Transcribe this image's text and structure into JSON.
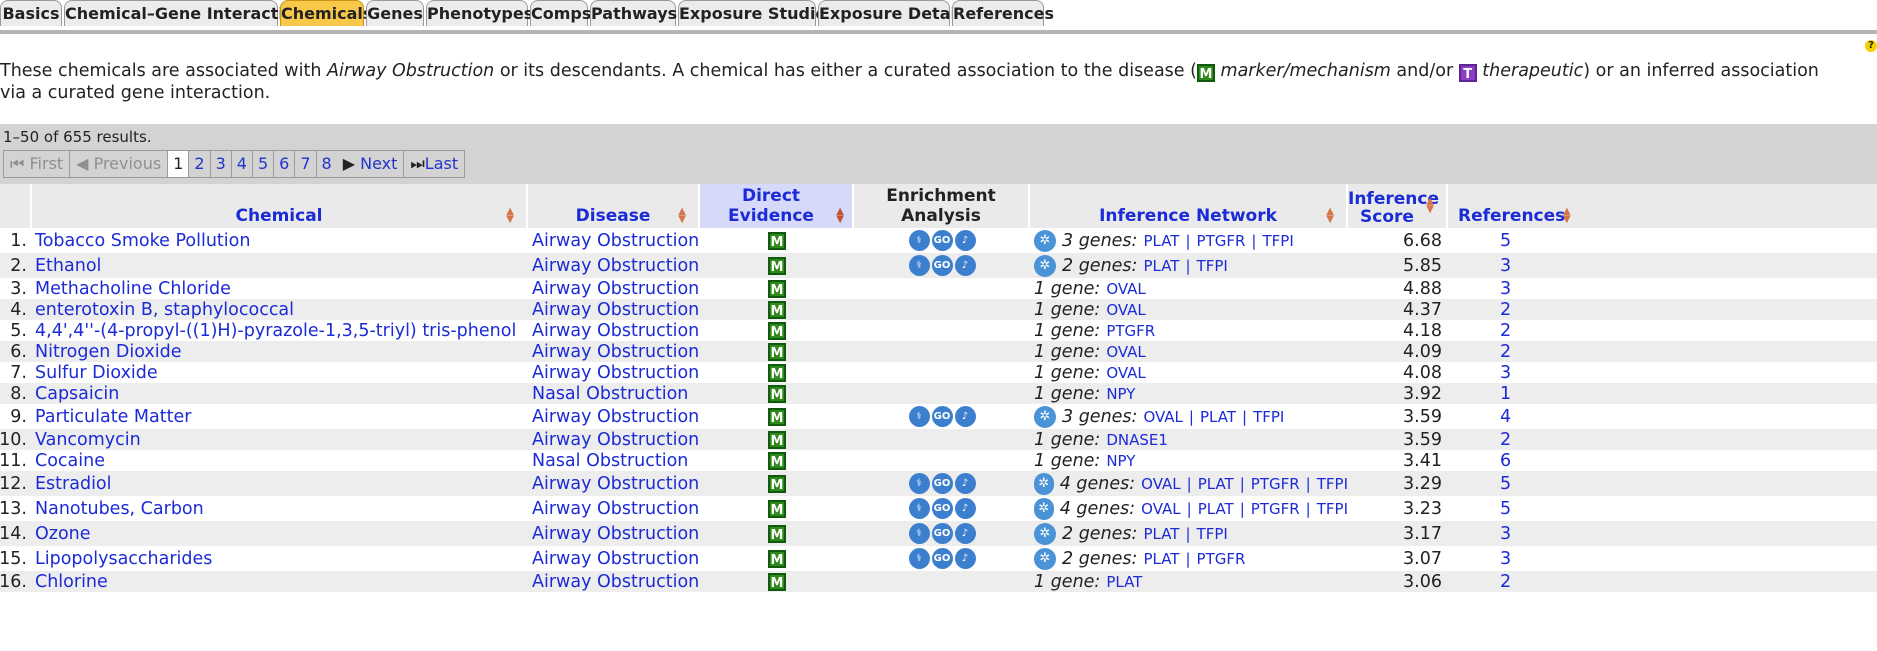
{
  "tabs": [
    "Basics",
    "Chemical–Gene Interactions",
    "Chemicals",
    "Genes",
    "Phenotypes",
    "Comps",
    "Pathways",
    "Exposure Studies",
    "Exposure Details",
    "References"
  ],
  "active_tab": "Chemicals",
  "help_label": "?",
  "intro": {
    "p1": "These chemicals are associated with ",
    "disease": "Airway Obstruction",
    "p2": " or its descendants. A chemical has either a curated association to the disease (",
    "m_badge": "M",
    "m_label": "marker/mechanism",
    "p3": " and/or ",
    "t_badge": "T",
    "t_label": "therapeutic",
    "p4": ") or an inferred association via a curated gene interaction."
  },
  "results_text": "1–50 of 655 results.",
  "pager": {
    "first": "First",
    "previous": "Previous",
    "pages": [
      "1",
      "2",
      "3",
      "4",
      "5",
      "6",
      "7",
      "8"
    ],
    "current": "1",
    "next": "Next",
    "last": "Last"
  },
  "columns": {
    "chemical": "Chemical",
    "disease": "Disease",
    "direct_evidence": "Direct Evidence",
    "enrichment": "Enrichment Analysis",
    "network": "Inference Network",
    "score_l1": "Inference",
    "score_l2": "Score",
    "references": "References"
  },
  "enrichment_icons": [
    "anatomy-icon",
    "go-icon",
    "pathway-icon"
  ],
  "network_icon": "network-icon",
  "rows": [
    {
      "n": "1.",
      "chemical": "Tobacco Smoke Pollution",
      "disease": "Airway Obstruction",
      "ev": "M",
      "enr": true,
      "gl": "3 genes:",
      "genes": [
        "PLAT",
        "PTGFR",
        "TFPI"
      ],
      "score": "6.68",
      "refs": "5"
    },
    {
      "n": "2.",
      "chemical": "Ethanol",
      "disease": "Airway Obstruction",
      "ev": "M",
      "enr": true,
      "gl": "2 genes:",
      "genes": [
        "PLAT",
        "TFPI"
      ],
      "score": "5.85",
      "refs": "3"
    },
    {
      "n": "3.",
      "chemical": "Methacholine Chloride",
      "disease": "Airway Obstruction",
      "ev": "M",
      "enr": false,
      "gl": "1 gene:",
      "genes": [
        "OVAL"
      ],
      "score": "4.88",
      "refs": "3"
    },
    {
      "n": "4.",
      "chemical": "enterotoxin B, staphylococcal",
      "disease": "Airway Obstruction",
      "ev": "M",
      "enr": false,
      "gl": "1 gene:",
      "genes": [
        "OVAL"
      ],
      "score": "4.37",
      "refs": "2"
    },
    {
      "n": "5.",
      "chemical": "4,4',4''-(4-propyl-((1)H)-pyrazole-1,3,5-triyl) tris-phenol",
      "disease": "Airway Obstruction",
      "ev": "M",
      "enr": false,
      "gl": "1 gene:",
      "genes": [
        "PTGFR"
      ],
      "score": "4.18",
      "refs": "2"
    },
    {
      "n": "6.",
      "chemical": "Nitrogen Dioxide",
      "disease": "Airway Obstruction",
      "ev": "M",
      "enr": false,
      "gl": "1 gene:",
      "genes": [
        "OVAL"
      ],
      "score": "4.09",
      "refs": "2"
    },
    {
      "n": "7.",
      "chemical": "Sulfur Dioxide",
      "disease": "Airway Obstruction",
      "ev": "M",
      "enr": false,
      "gl": "1 gene:",
      "genes": [
        "OVAL"
      ],
      "score": "4.08",
      "refs": "3"
    },
    {
      "n": "8.",
      "chemical": "Capsaicin",
      "disease": "Nasal Obstruction",
      "ev": "M",
      "enr": false,
      "gl": "1 gene:",
      "genes": [
        "NPY"
      ],
      "score": "3.92",
      "refs": "1"
    },
    {
      "n": "9.",
      "chemical": "Particulate Matter",
      "disease": "Airway Obstruction",
      "ev": "M",
      "enr": true,
      "gl": "3 genes:",
      "genes": [
        "OVAL",
        "PLAT",
        "TFPI"
      ],
      "score": "3.59",
      "refs": "4"
    },
    {
      "n": "10.",
      "chemical": "Vancomycin",
      "disease": "Airway Obstruction",
      "ev": "M",
      "enr": false,
      "gl": "1 gene:",
      "genes": [
        "DNASE1"
      ],
      "score": "3.59",
      "refs": "2"
    },
    {
      "n": "11.",
      "chemical": "Cocaine",
      "disease": "Nasal Obstruction",
      "ev": "M",
      "enr": false,
      "gl": "1 gene:",
      "genes": [
        "NPY"
      ],
      "score": "3.41",
      "refs": "6"
    },
    {
      "n": "12.",
      "chemical": "Estradiol",
      "disease": "Airway Obstruction",
      "ev": "M",
      "enr": true,
      "gl": "4 genes:",
      "genes": [
        "OVAL",
        "PLAT",
        "PTGFR",
        "TFPI"
      ],
      "score": "3.29",
      "refs": "5"
    },
    {
      "n": "13.",
      "chemical": "Nanotubes, Carbon",
      "disease": "Airway Obstruction",
      "ev": "M",
      "enr": true,
      "gl": "4 genes:",
      "genes": [
        "OVAL",
        "PLAT",
        "PTGFR",
        "TFPI"
      ],
      "score": "3.23",
      "refs": "5"
    },
    {
      "n": "14.",
      "chemical": "Ozone",
      "disease": "Airway Obstruction",
      "ev": "M",
      "enr": true,
      "gl": "2 genes:",
      "genes": [
        "PLAT",
        "TFPI"
      ],
      "score": "3.17",
      "refs": "3"
    },
    {
      "n": "15.",
      "chemical": "Lipopolysaccharides",
      "disease": "Airway Obstruction",
      "ev": "M",
      "enr": true,
      "gl": "2 genes:",
      "genes": [
        "PLAT",
        "PTGFR"
      ],
      "score": "3.07",
      "refs": "3"
    },
    {
      "n": "16.",
      "chemical": "Chlorine",
      "disease": "Airway Obstruction",
      "ev": "M",
      "enr": false,
      "gl": "1 gene:",
      "genes": [
        "PLAT"
      ],
      "score": "3.06",
      "refs": "2"
    }
  ]
}
